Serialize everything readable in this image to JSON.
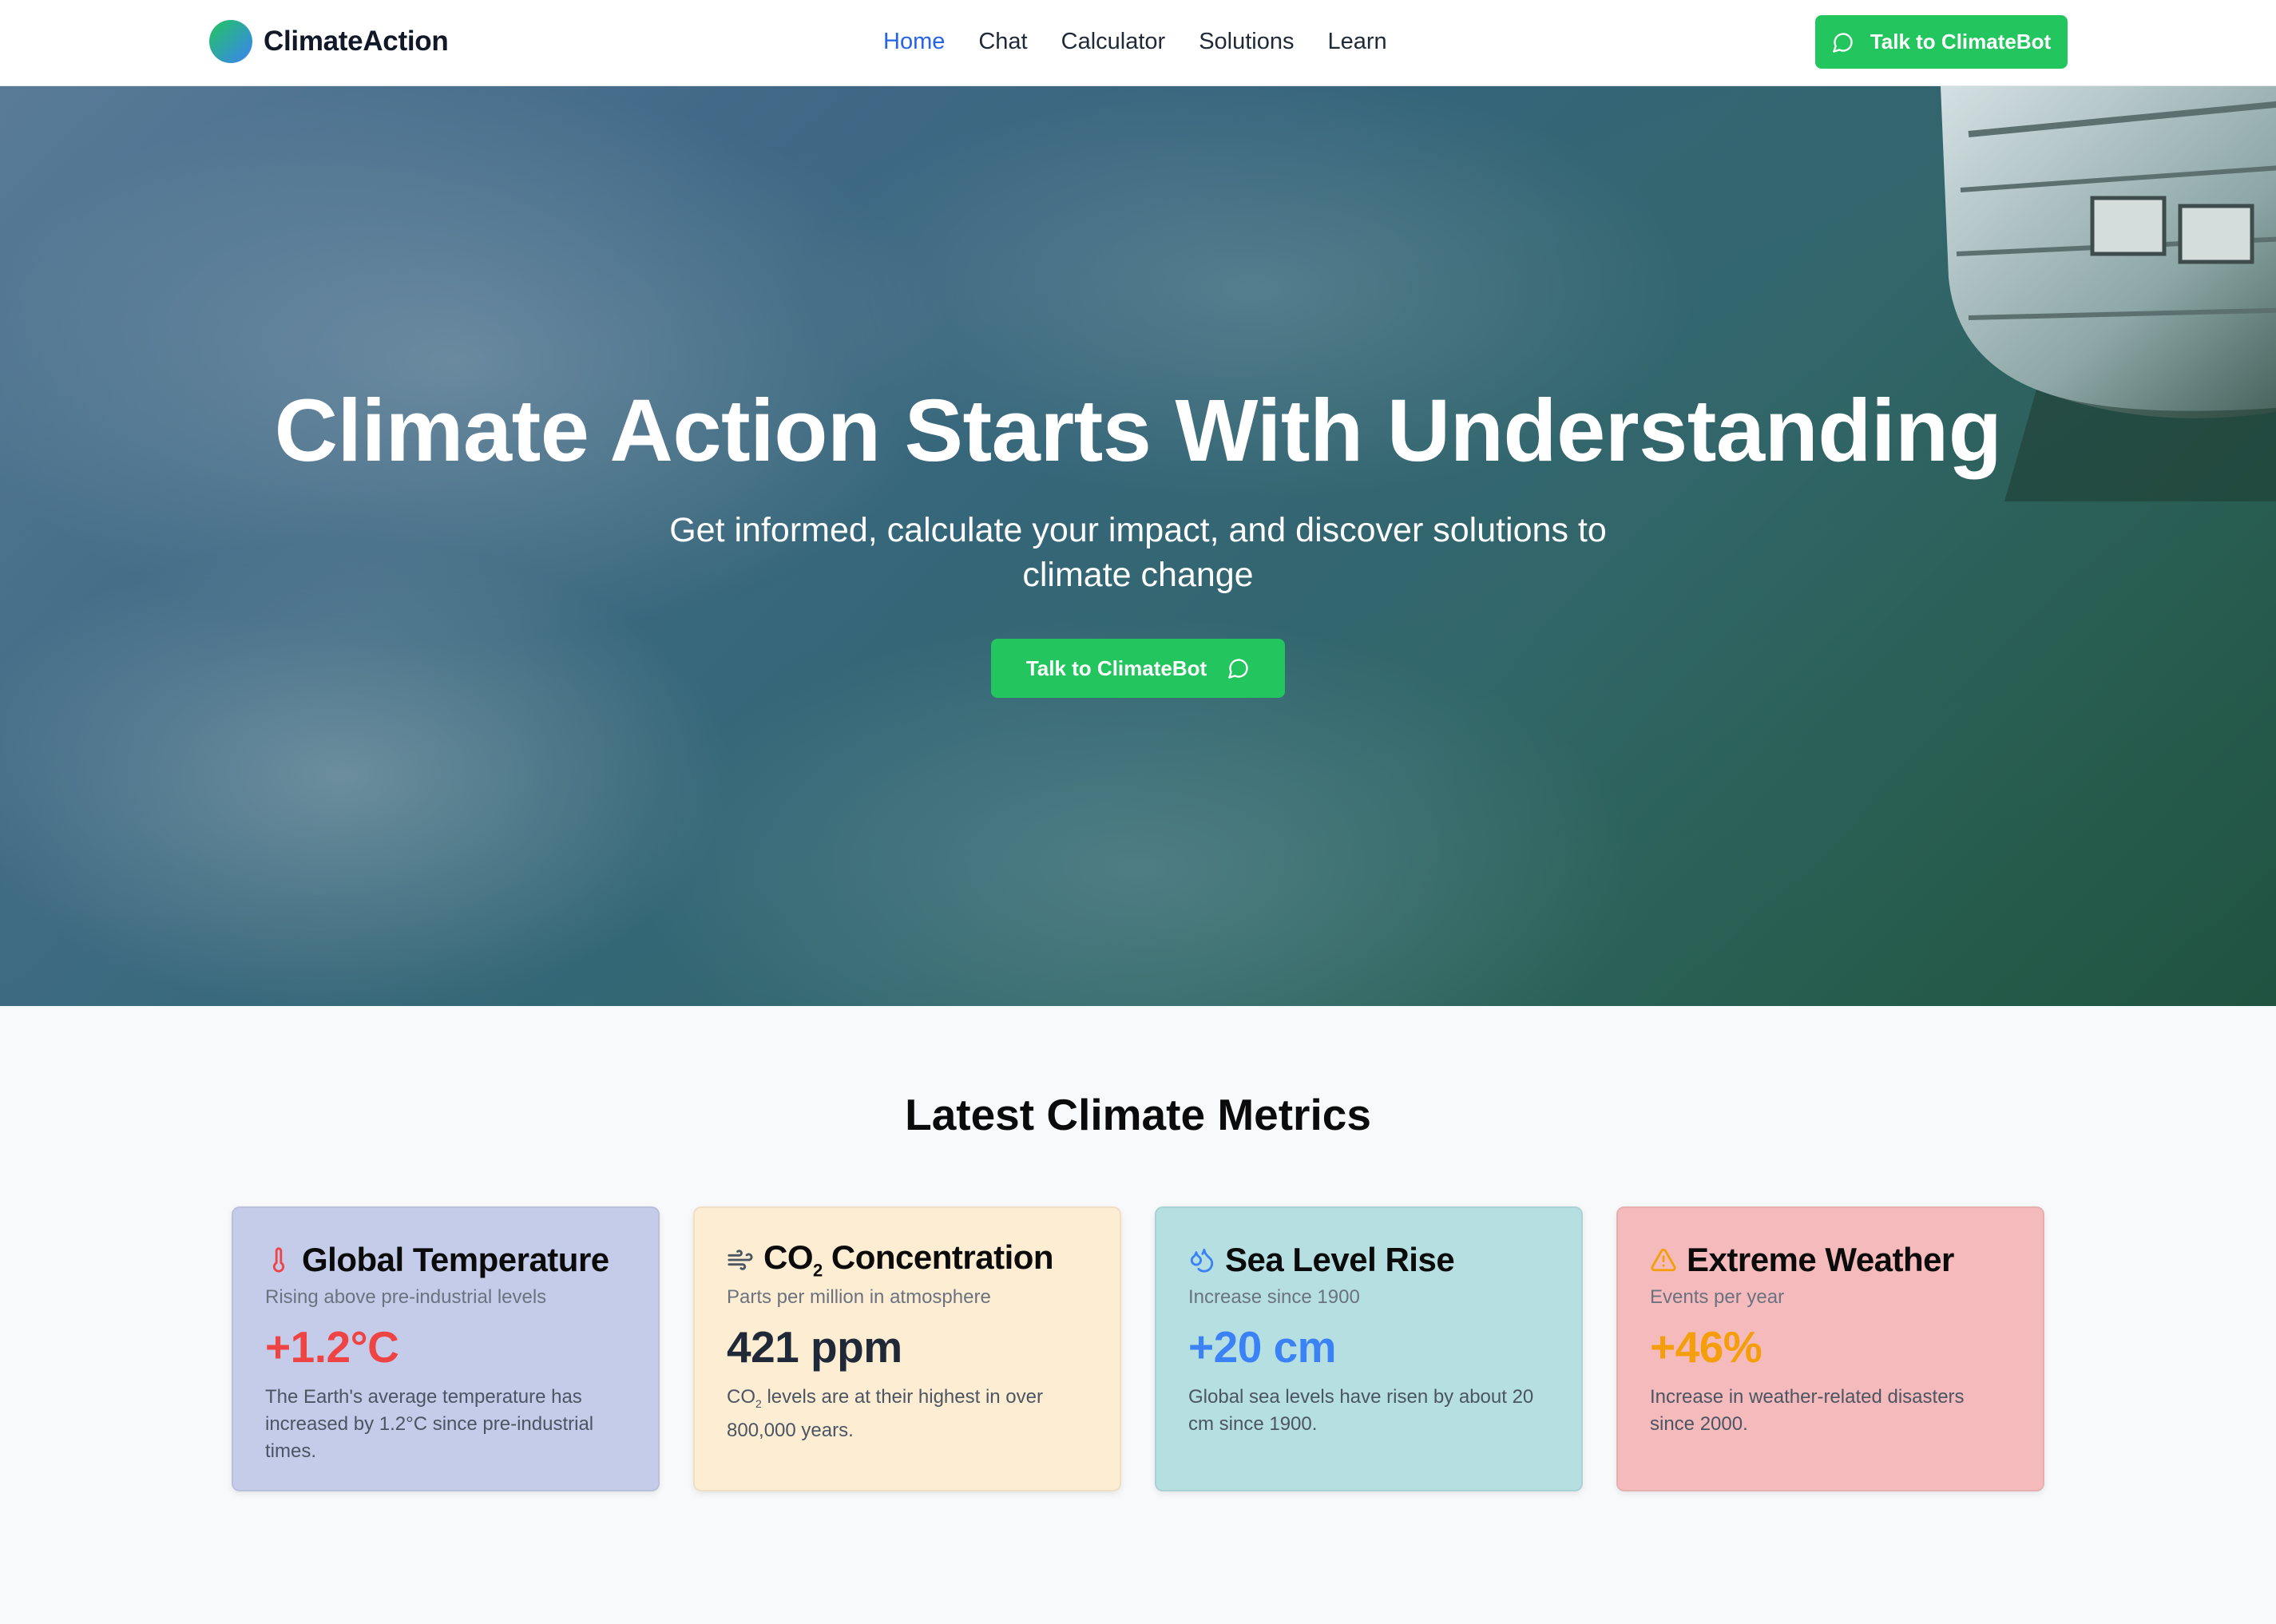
{
  "nav": {
    "brand": "ClimateAction",
    "links": [
      "Home",
      "Chat",
      "Calculator",
      "Solutions",
      "Learn"
    ],
    "active_link": "Home",
    "cta_label": "Talk to ClimateBot"
  },
  "hero": {
    "title": "Climate Action Starts With Understanding",
    "subtitle": "Get informed, calculate your impact, and discover solutions to climate change",
    "cta_label": "Talk to ClimateBot"
  },
  "metrics": {
    "section_title": "Latest Climate Metrics",
    "cards": [
      {
        "icon": "thermometer-icon",
        "title": "Global Temperature",
        "subtitle": "Rising above pre-industrial levels",
        "value": "+1.2°C",
        "value_color": "#ef4444",
        "bg": "#c4cce9",
        "description": "The Earth's average temperature has increased by 1.2°C since pre-industrial times."
      },
      {
        "icon": "wind-icon",
        "title_main": "CO",
        "title_sub": "2",
        "title_rest": " Concentration",
        "subtitle": "Parts per million in atmosphere",
        "value": "421 ppm",
        "value_color": "#1f2937",
        "bg": "#fdedd3",
        "desc_main": "CO",
        "desc_sub": "2",
        "desc_rest": " levels are at their highest in over 800,000 years."
      },
      {
        "icon": "droplets-icon",
        "title": "Sea Level Rise",
        "subtitle": "Increase since 1900",
        "value": "+20 cm",
        "value_color": "#3b82f6",
        "bg": "#b5dfe1",
        "description": "Global sea levels have risen by about 20 cm since 1900."
      },
      {
        "icon": "warning-icon",
        "title": "Extreme Weather",
        "subtitle": "Events per year",
        "value": "+46%",
        "value_color": "#f59e0b",
        "bg": "#f5babb",
        "description": "Increase in weather-related disasters since 2000."
      }
    ]
  }
}
